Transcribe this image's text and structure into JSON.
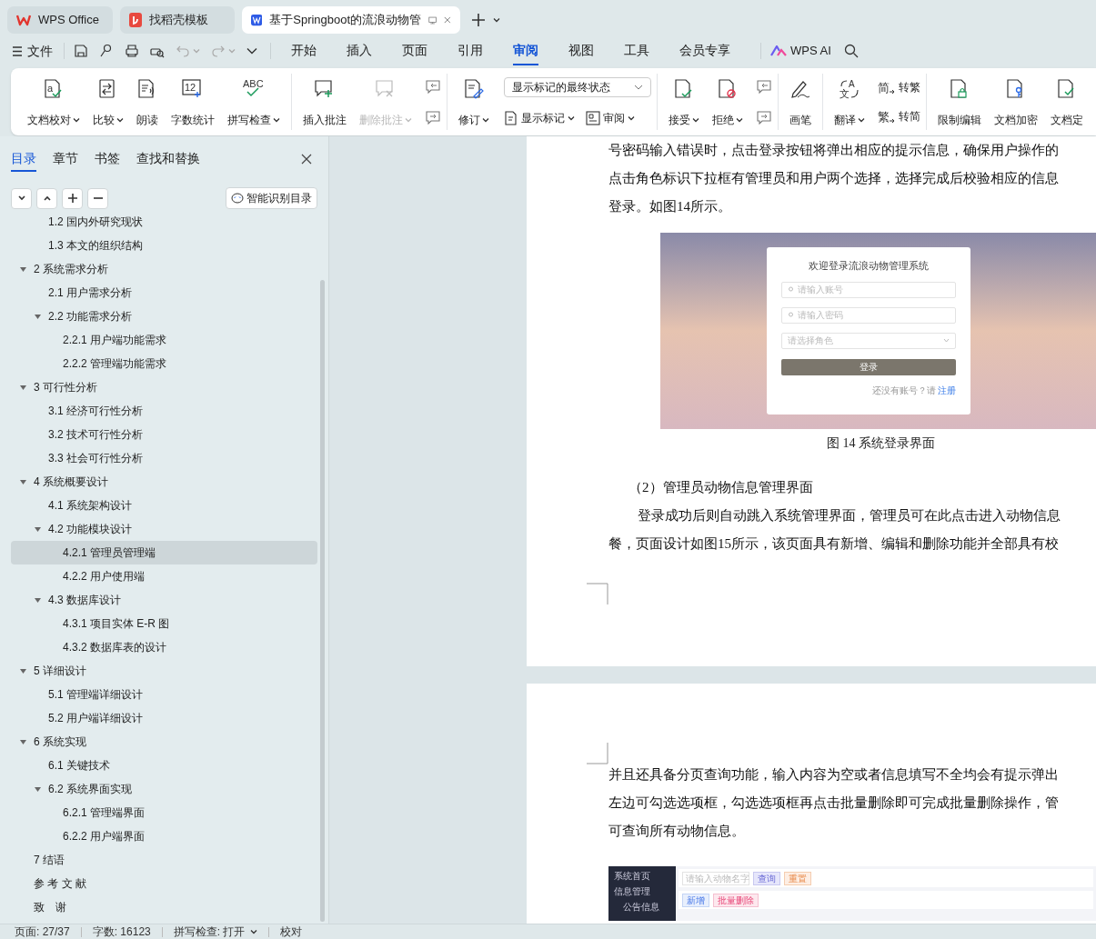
{
  "tabs": [
    {
      "label": "WPS Office",
      "kind": "home",
      "selected": false
    },
    {
      "label": "找稻壳模板",
      "kind": "template",
      "selected": false
    },
    {
      "label": "基于Springboot的流浪动物管",
      "kind": "doc",
      "selected": true
    }
  ],
  "menu": {
    "file": "文件",
    "items": [
      {
        "label": "开始",
        "selected": false
      },
      {
        "label": "插入",
        "selected": false
      },
      {
        "label": "页面",
        "selected": false
      },
      {
        "label": "引用",
        "selected": false
      },
      {
        "label": "审阅",
        "selected": true
      },
      {
        "label": "视图",
        "selected": false
      },
      {
        "label": "工具",
        "selected": false
      },
      {
        "label": "会员专享",
        "selected": false
      }
    ],
    "ai": "WPS AI"
  },
  "ribbon": [
    {
      "buttons": [
        {
          "label": "文档校对",
          "icon_text": "a",
          "caret": true,
          "disabled": false
        },
        {
          "label": "比较",
          "caret": true,
          "disabled": false
        },
        {
          "label": "朗读",
          "caret": false,
          "disabled": false
        },
        {
          "label": "字数统计",
          "icon_text": "12",
          "caret": false,
          "disabled": false
        },
        {
          "label": "拼写检查",
          "icon_text": "ABC",
          "caret": true,
          "disabled": false
        }
      ]
    },
    {
      "buttons": [
        {
          "label": "插入批注",
          "caret": false,
          "disabled": false
        },
        {
          "label": "删除批注",
          "caret": true,
          "disabled": true
        }
      ]
    },
    {
      "buttons": [
        {
          "label": "修订",
          "caret": true,
          "disabled": false
        }
      ],
      "dropdown": "显示标记的最终状态",
      "small_buttons": [
        {
          "label": "显示标记"
        },
        {
          "label": "审阅"
        }
      ]
    },
    {
      "buttons": [
        {
          "label": "接受",
          "caret": true,
          "disabled": false
        },
        {
          "label": "拒绝",
          "caret": true,
          "disabled": false
        }
      ]
    },
    {
      "buttons": [
        {
          "label": "画笔",
          "caret": false,
          "disabled": false
        }
      ]
    },
    {
      "buttons": [
        {
          "label": "翻译",
          "icon_text": "A",
          "icon_text_2": "文",
          "caret": true,
          "disabled": false
        }
      ],
      "small_buttons": [
        {
          "label": "转繁",
          "icon_text": "简"
        },
        {
          "label": "转简",
          "icon_text": "繁"
        }
      ]
    },
    {
      "buttons": [
        {
          "label": "限制编辑",
          "caret": false,
          "disabled": false
        },
        {
          "label": "文档加密",
          "caret": false,
          "disabled": false
        },
        {
          "label": "文档定",
          "caret": false,
          "disabled": false
        }
      ]
    }
  ],
  "nav": {
    "tabs": [
      {
        "label": "目录",
        "selected": true
      },
      {
        "label": "章节",
        "selected": false
      },
      {
        "label": "书签",
        "selected": false
      },
      {
        "label": "查找和替换",
        "selected": false
      }
    ],
    "smart_button": "智能识别目录",
    "items": [
      {
        "label": "1.2 国内外研究现状",
        "kind": "continued",
        "selected": false
      },
      {
        "label": "1.3 本文的组织结构",
        "kind": "continued",
        "selected": false
      },
      {
        "label": "2 系统需求分析",
        "expanded": true,
        "selected": false,
        "children": [
          {
            "label": "2.1 用户需求分析",
            "selected": false
          },
          {
            "label": "2.2 功能需求分析",
            "expanded": true,
            "selected": false,
            "children": [
              {
                "label": "2.2.1 用户端功能需求",
                "selected": false
              },
              {
                "label": "2.2.2 管理端功能需求",
                "selected": false
              }
            ]
          }
        ]
      },
      {
        "label": "3 可行性分析",
        "expanded": true,
        "selected": false,
        "children": [
          {
            "label": "3.1 经济可行性分析",
            "selected": false
          },
          {
            "label": "3.2 技术可行性分析",
            "selected": false
          },
          {
            "label": "3.3 社会可行性分析",
            "selected": false
          }
        ]
      },
      {
        "label": "4 系统概要设计",
        "expanded": true,
        "selected": false,
        "children": [
          {
            "label": "4.1 系统架构设计",
            "selected": false
          },
          {
            "label": "4.2 功能模块设计",
            "expanded": true,
            "selected": false,
            "children": [
              {
                "label": "4.2.1 管理员管理端",
                "selected": true
              },
              {
                "label": "4.2.2 用户使用端",
                "selected": false
              }
            ]
          },
          {
            "label": "4.3 数据库设计",
            "expanded": true,
            "selected": false,
            "children": [
              {
                "label": "4.3.1 项目实体 E-R 图",
                "selected": false
              },
              {
                "label": "4.3.2 数据库表的设计",
                "selected": false
              }
            ]
          }
        ]
      },
      {
        "label": "5 详细设计",
        "expanded": true,
        "selected": false,
        "children": [
          {
            "label": "5.1 管理端详细设计",
            "selected": false
          },
          {
            "label": "5.2 用户端详细设计",
            "selected": false
          }
        ]
      },
      {
        "label": "6  系统实现",
        "expanded": true,
        "selected": false,
        "children": [
          {
            "label": "6.1 关键技术",
            "selected": false
          },
          {
            "label": "6.2 系统界面实现",
            "expanded": true,
            "selected": false,
            "children": [
              {
                "label": "6.2.1 管理端界面",
                "selected": false
              },
              {
                "label": "6.2.2 用户端界面",
                "selected": false
              }
            ]
          }
        ]
      },
      {
        "label": "7 结语",
        "selected": false
      },
      {
        "label": "参 考 文 献",
        "selected": false
      },
      {
        "label": "致　谢",
        "selected": false
      }
    ]
  },
  "page1": {
    "lines": [
      "号密码输入错误时，点击登录按钮将弹出相应的提示信息，确保用户操作的",
      "点击角色标识下拉框有管理员和用户两个选择，选择完成后校验相应的信息",
      "登录。如图14所示。"
    ],
    "login_screenshot": {
      "title": "欢迎登录流浪动物管理系统",
      "account_placeholder": "请输入账号",
      "password_placeholder": "请输入密码",
      "role_placeholder": "请选择角色",
      "button": "登录",
      "register_prompt": "还没有账号？请",
      "register_link": "注册"
    },
    "caption": "图 14  系统登录界面",
    "heading": "（2）管理员动物信息管理界面",
    "para": [
      "登录成功后则自动跳入系统管理界面，管理员可在此点击进入动物信息",
      "餐，页面设计如图15所示，该页面具有新增、编辑和删除功能并全部具有校"
    ]
  },
  "page2": {
    "lines": [
      "并且还具备分页查询功能，输入内容为空或者信息填写不全均会有提示弹出",
      "左边可勾选选项框，勾选选项框再点击批量删除即可完成批量删除操作，管",
      "可查询所有动物信息。"
    ],
    "admin_screenshot": {
      "sidebar": [
        "系统首页",
        "信息管理",
        "公告信息"
      ],
      "search_placeholder": "请输入动物名字",
      "search": "查询",
      "reset": "重置",
      "add": "新增",
      "batch_delete": "批量删除"
    }
  },
  "status_bar": [
    "页面: 27/37",
    "字数: 16123",
    "拼写检查: 打开",
    "校对"
  ]
}
